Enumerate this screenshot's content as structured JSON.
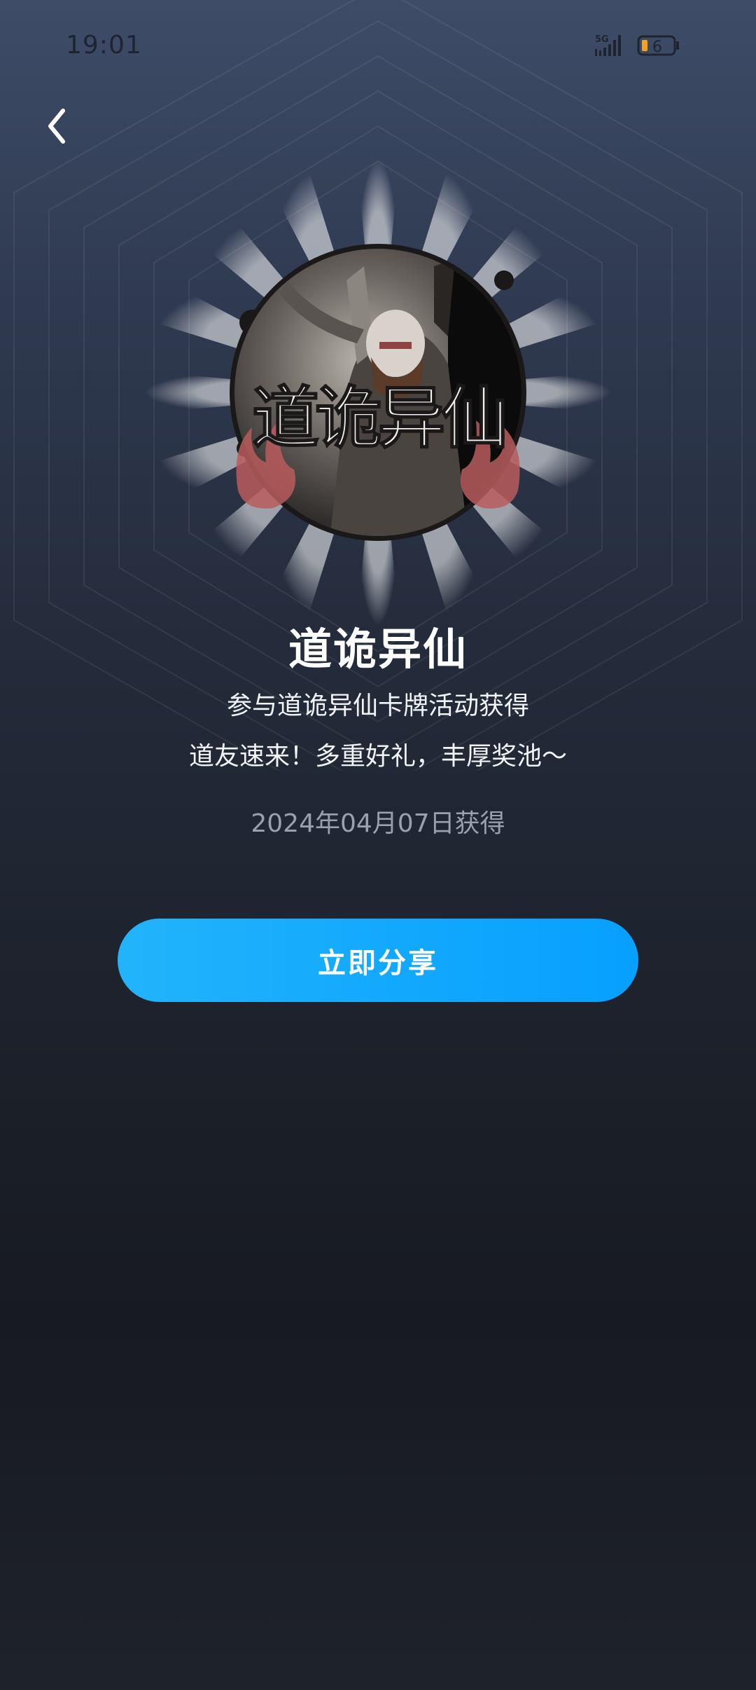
{
  "status_bar": {
    "time": "19:01",
    "network": "5G",
    "battery": "6"
  },
  "nav": {
    "back_icon": "chevron-left-icon"
  },
  "badge": {
    "image": "dao-gui-yi-xian-badge",
    "calligraphy": "道诡异仙"
  },
  "content": {
    "title": "道诡异仙",
    "description_line1": "参与道诡异仙卡牌活动获得",
    "description_line2": "道友速来！多重好礼，丰厚奖池～",
    "obtained_date": "2024年04月07日获得"
  },
  "actions": {
    "share_label": "立即分享"
  },
  "colors": {
    "accent": "#12a8fd",
    "background_top": "#3e4c68",
    "background_bottom": "#171a20"
  }
}
